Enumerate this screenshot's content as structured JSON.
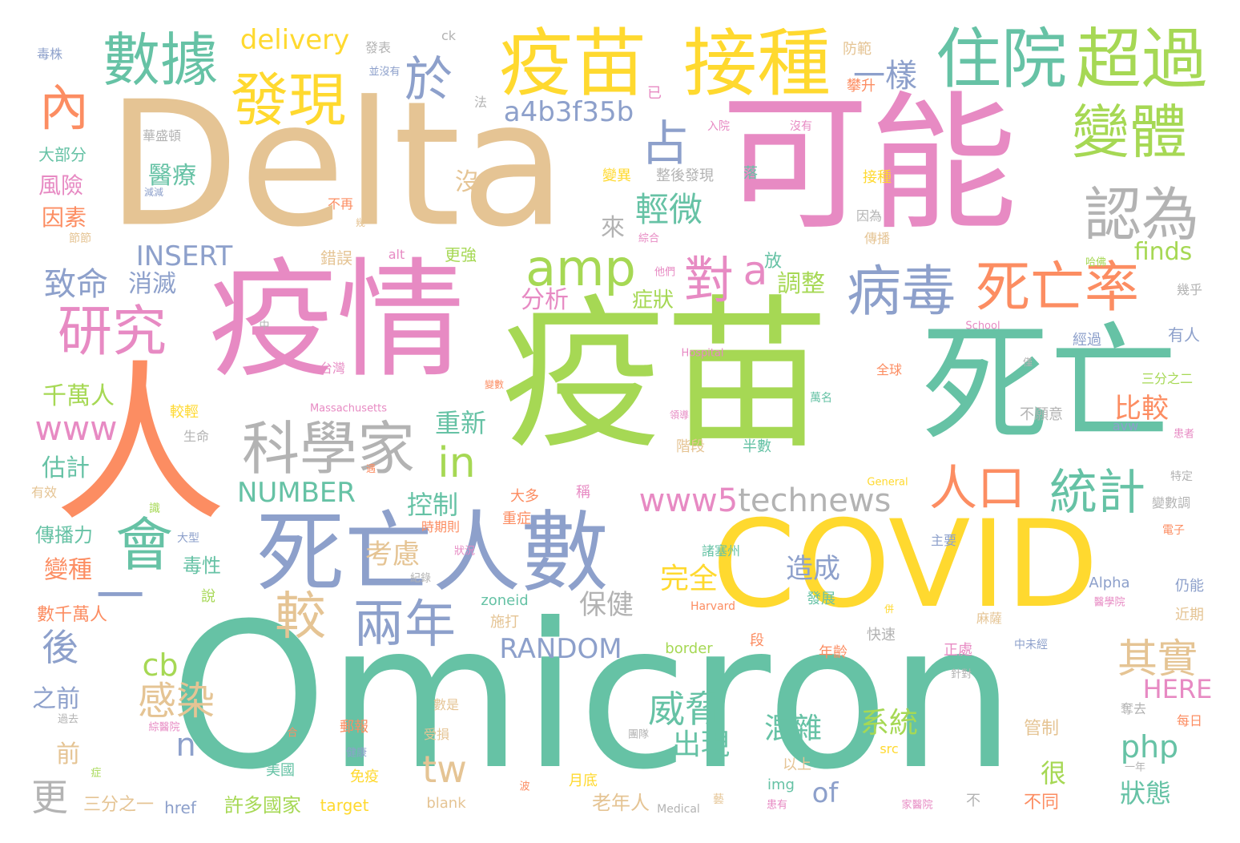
{
  "words": [
    {
      "text": "Omicron",
      "color": "#66c2a5"
    },
    {
      "text": "疫苗",
      "color": "#a6d854"
    },
    {
      "text": "Delta",
      "color": "#e5c494"
    },
    {
      "text": "可能",
      "color": "#e78ac3"
    },
    {
      "text": "疫情",
      "color": "#e78ac3"
    },
    {
      "text": "死亡",
      "color": "#66c2a5"
    },
    {
      "text": "COVID",
      "color": "#ffd92f"
    },
    {
      "text": "人",
      "color": "#fc8d62"
    },
    {
      "text": "死亡人數",
      "color": "#8da0cb"
    },
    {
      "text": "疫苗",
      "color": "#ffd92f"
    },
    {
      "text": "接種",
      "color": "#ffd92f"
    },
    {
      "text": "超過",
      "color": "#a6d854"
    },
    {
      "text": "住院",
      "color": "#66c2a5"
    },
    {
      "text": "數據",
      "color": "#66c2a5"
    },
    {
      "text": "發現",
      "color": "#ffd92f"
    },
    {
      "text": "變體",
      "color": "#a6d854"
    },
    {
      "text": "認為",
      "color": "#b3b3b3"
    },
    {
      "text": "科學家",
      "color": "#b3b3b3"
    },
    {
      "text": "研究",
      "color": "#e78ac3"
    },
    {
      "text": "病毒",
      "color": "#8da0cb"
    },
    {
      "text": "死亡率",
      "color": "#fc8d62"
    },
    {
      "text": "會",
      "color": "#66c2a5"
    },
    {
      "text": "一",
      "color": "#8da0cb"
    },
    {
      "text": "兩年",
      "color": "#8da0cb"
    },
    {
      "text": "較",
      "color": "#e5c494"
    },
    {
      "text": "人口",
      "color": "#fc8d62"
    },
    {
      "text": "統計",
      "color": "#66c2a5"
    },
    {
      "text": "amp",
      "color": "#a6d854"
    },
    {
      "text": "對",
      "color": "#e78ac3"
    },
    {
      "text": "a",
      "color": "#e78ac3"
    },
    {
      "text": "占",
      "color": "#8da0cb"
    },
    {
      "text": "內",
      "color": "#fc8d62"
    },
    {
      "text": "於",
      "color": "#8da0cb"
    },
    {
      "text": "in",
      "color": "#a6d854"
    },
    {
      "text": "www5technews",
      "color": "#e78ac3",
      "split": "www5",
      "rest": "technews",
      "rest_color": "#b3b3b3"
    },
    {
      "text": "其實",
      "color": "#e5c494"
    },
    {
      "text": "威脅",
      "color": "#66c2a5"
    },
    {
      "text": "感染",
      "color": "#e5c494"
    },
    {
      "text": "後",
      "color": "#8da0cb"
    },
    {
      "text": "www",
      "color": "#e78ac3"
    },
    {
      "text": "更",
      "color": "#b3b3b3"
    },
    {
      "text": "tw",
      "color": "#e5c494"
    },
    {
      "text": "n",
      "color": "#8da0cb"
    },
    {
      "text": "cb",
      "color": "#a6d854"
    },
    {
      "text": "一樣",
      "color": "#8da0cb"
    },
    {
      "text": "輕微",
      "color": "#66c2a5"
    },
    {
      "text": "a4b3f35b",
      "color": "#8da0cb"
    },
    {
      "text": "delivery",
      "color": "#ffd92f"
    },
    {
      "text": "致命",
      "color": "#8da0cb"
    },
    {
      "text": "INSERT",
      "color": "#8da0cb"
    },
    {
      "text": "NUMBER",
      "color": "#66c2a5"
    },
    {
      "text": "RANDOM",
      "color": "#8da0cb"
    },
    {
      "text": "php",
      "color": "#66c2a5"
    },
    {
      "text": "of",
      "color": "#8da0cb"
    },
    {
      "text": "出現",
      "color": "#66c2a5"
    },
    {
      "text": "混雜",
      "color": "#66c2a5"
    },
    {
      "text": "系統",
      "color": "#a6d854"
    },
    {
      "text": "完全",
      "color": "#ffd92f"
    },
    {
      "text": "造成",
      "color": "#8da0cb"
    },
    {
      "text": "保健",
      "color": "#b3b3b3"
    },
    {
      "text": "考慮",
      "color": "#e5c494"
    },
    {
      "text": "控制",
      "color": "#66c2a5"
    },
    {
      "text": "重新",
      "color": "#66c2a5"
    },
    {
      "text": "比較",
      "color": "#fc8d62"
    },
    {
      "text": "finds",
      "color": "#a6d854"
    },
    {
      "text": "HERE",
      "color": "#e78ac3"
    },
    {
      "text": "狀態",
      "color": "#66c2a5"
    },
    {
      "text": "很",
      "color": "#a6d854"
    },
    {
      "text": "醫療",
      "color": "#66c2a5"
    },
    {
      "text": "消滅",
      "color": "#8da0cb"
    },
    {
      "text": "分析",
      "color": "#e78ac3"
    },
    {
      "text": "調整",
      "color": "#a6d854"
    },
    {
      "text": "來",
      "color": "#b3b3b3"
    },
    {
      "text": "沒",
      "color": "#e5c494"
    },
    {
      "text": "症狀",
      "color": "#a6d854"
    },
    {
      "text": "千萬人",
      "color": "#a6d854"
    },
    {
      "text": "估計",
      "color": "#66c2a5"
    },
    {
      "text": "之前",
      "color": "#8da0cb"
    },
    {
      "text": "前",
      "color": "#e5c494"
    },
    {
      "text": "變種",
      "color": "#fc8d62"
    },
    {
      "text": "風險",
      "color": "#e78ac3"
    },
    {
      "text": "因素",
      "color": "#fc8d62"
    },
    {
      "text": "毒性",
      "color": "#66c2a5"
    },
    {
      "text": "傳播力",
      "color": "#66c2a5"
    },
    {
      "text": "數千萬人",
      "color": "#fc8d62"
    },
    {
      "text": "三分之一",
      "color": "#e5c494"
    },
    {
      "text": "許多國家",
      "color": "#a6d854"
    },
    {
      "text": "老年人",
      "color": "#e5c494"
    },
    {
      "text": "不同",
      "color": "#fc8d62"
    },
    {
      "text": "管制",
      "color": "#e5c494"
    },
    {
      "text": "放",
      "color": "#66c2a5"
    },
    {
      "text": "更強",
      "color": "#a6d854"
    },
    {
      "text": "錯誤",
      "color": "#e5c494"
    },
    {
      "text": "大部分",
      "color": "#66c2a5"
    },
    {
      "text": "華盛頓",
      "color": "#b3b3b3"
    },
    {
      "text": "毒株",
      "color": "#8da0cb"
    },
    {
      "text": "發表",
      "color": "#b3b3b3"
    },
    {
      "text": "ck",
      "color": "#b3b3b3"
    },
    {
      "text": "防範",
      "color": "#e5c494"
    },
    {
      "text": "攀升",
      "color": "#fc8d62"
    },
    {
      "text": "入院",
      "color": "#e78ac3"
    },
    {
      "text": "沒有",
      "color": "#e78ac3"
    },
    {
      "text": "已",
      "color": "#e78ac3"
    },
    {
      "text": "法",
      "color": "#b3b3b3"
    },
    {
      "text": "並沒有",
      "color": "#8da0cb"
    },
    {
      "text": "變異",
      "color": "#ffd92f"
    },
    {
      "text": "整後發現",
      "color": "#b3b3b3"
    },
    {
      "text": "落",
      "color": "#66c2a5"
    },
    {
      "text": "接種",
      "color": "#ffd92f"
    },
    {
      "text": "因為",
      "color": "#b3b3b3"
    },
    {
      "text": "傳播",
      "color": "#e5c494"
    },
    {
      "text": "綜合",
      "color": "#e78ac3"
    },
    {
      "text": "他們",
      "color": "#e78ac3"
    },
    {
      "text": "哈佛",
      "color": "#a6d854"
    },
    {
      "text": "幾乎",
      "color": "#b3b3b3"
    },
    {
      "text": "有人",
      "color": "#8da0cb"
    },
    {
      "text": "School",
      "color": "#e78ac3"
    },
    {
      "text": "經過",
      "color": "#8da0cb"
    },
    {
      "text": "Hospital",
      "color": "#e78ac3"
    },
    {
      "text": "全球",
      "color": "#fc8d62"
    },
    {
      "text": "三分之二",
      "color": "#a6d854"
    },
    {
      "text": "台灣",
      "color": "#e78ac3"
    },
    {
      "text": "中",
      "color": "#b3b3b3"
    },
    {
      "text": "Massachusetts",
      "color": "#e78ac3"
    },
    {
      "text": "萬名",
      "color": "#66c2a5"
    },
    {
      "text": "不願意",
      "color": "#b3b3b3"
    },
    {
      "text": "avw",
      "color": "#8da0cb"
    },
    {
      "text": "患者",
      "color": "#e78ac3"
    },
    {
      "text": "較輕",
      "color": "#ffd92f"
    },
    {
      "text": "生命",
      "color": "#b3b3b3"
    },
    {
      "text": "階段",
      "color": "#e5c494"
    },
    {
      "text": "半數",
      "color": "#66c2a5"
    },
    {
      "text": "大多",
      "color": "#fc8d62"
    },
    {
      "text": "稱",
      "color": "#e78ac3"
    },
    {
      "text": "重症",
      "color": "#fc8d62"
    },
    {
      "text": "時期則",
      "color": "#fc8d62"
    },
    {
      "text": "General",
      "color": "#ffd92f"
    },
    {
      "text": "特定",
      "color": "#b3b3b3"
    },
    {
      "text": "變數調",
      "color": "#b3b3b3"
    },
    {
      "text": "電子",
      "color": "#fc8d62"
    },
    {
      "text": "主要",
      "color": "#8da0cb"
    },
    {
      "text": "諸塞州",
      "color": "#66c2a5"
    },
    {
      "text": "大型",
      "color": "#8da0cb"
    },
    {
      "text": "紀錄",
      "color": "#b3b3b3"
    },
    {
      "text": "狀況",
      "color": "#e78ac3"
    },
    {
      "text": "有效",
      "color": "#e5c494"
    },
    {
      "text": "說",
      "color": "#a6d854"
    },
    {
      "text": "zoneid",
      "color": "#66c2a5"
    },
    {
      "text": "施打",
      "color": "#e5c494"
    },
    {
      "text": "Harvard",
      "color": "#fc8d62"
    },
    {
      "text": "發展",
      "color": "#66c2a5"
    },
    {
      "text": "Alpha",
      "color": "#8da0cb"
    },
    {
      "text": "醫學院",
      "color": "#e78ac3"
    },
    {
      "text": "仍能",
      "color": "#8da0cb"
    },
    {
      "text": "近期",
      "color": "#e5c494"
    },
    {
      "text": "麻薩",
      "color": "#e5c494"
    },
    {
      "text": "快速",
      "color": "#b3b3b3"
    },
    {
      "text": "border",
      "color": "#a6d854"
    },
    {
      "text": "段",
      "color": "#fc8d62"
    },
    {
      "text": "年齡",
      "color": "#fc8d62"
    },
    {
      "text": "正處",
      "color": "#e78ac3"
    },
    {
      "text": "中未經",
      "color": "#8da0cb"
    },
    {
      "text": "針對",
      "color": "#b3b3b3"
    },
    {
      "text": "奪去",
      "color": "#b3b3b3"
    },
    {
      "text": "每日",
      "color": "#fc8d62"
    },
    {
      "text": "數是",
      "color": "#e5c494"
    },
    {
      "text": "郵報",
      "color": "#fc8d62"
    },
    {
      "text": "受損",
      "color": "#e5c494"
    },
    {
      "text": "src",
      "color": "#ffd92f"
    },
    {
      "text": "綜醫院",
      "color": "#e78ac3"
    },
    {
      "text": "過去",
      "color": "#b3b3b3"
    },
    {
      "text": "合",
      "color": "#fc8d62"
    },
    {
      "text": "健康",
      "color": "#8da0cb"
    },
    {
      "text": "團隊",
      "color": "#b3b3b3"
    },
    {
      "text": "美國",
      "color": "#66c2a5"
    },
    {
      "text": "以上",
      "color": "#e5c494"
    },
    {
      "text": "img",
      "color": "#66c2a5"
    },
    {
      "text": "免疫",
      "color": "#ffd92f"
    },
    {
      "text": "月底",
      "color": "#ffd92f"
    },
    {
      "text": "一年",
      "color": "#b3b3b3"
    },
    {
      "text": "症",
      "color": "#a6d854"
    },
    {
      "text": "波",
      "color": "#fc8d62"
    },
    {
      "text": "href",
      "color": "#8da0cb"
    },
    {
      "text": "target",
      "color": "#ffd92f"
    },
    {
      "text": "blank",
      "color": "#e5c494"
    },
    {
      "text": "Medical",
      "color": "#b3b3b3"
    },
    {
      "text": "患有",
      "color": "#e78ac3"
    },
    {
      "text": "家醫院",
      "color": "#e78ac3"
    },
    {
      "text": "不",
      "color": "#b3b3b3"
    },
    {
      "text": "alt",
      "color": "#e78ac3"
    },
    {
      "text": "節節",
      "color": "#e5c494"
    },
    {
      "text": "減減",
      "color": "#8da0cb"
    },
    {
      "text": "不再",
      "color": "#fc8d62"
    },
    {
      "text": "幾",
      "color": "#e5c494"
    },
    {
      "text": "遇",
      "color": "#fc8d62"
    },
    {
      "text": "領導",
      "color": "#e78ac3"
    },
    {
      "text": "變數",
      "color": "#fc8d62"
    },
    {
      "text": "僅",
      "color": "#b3b3b3"
    },
    {
      "text": "識",
      "color": "#a6d854"
    },
    {
      "text": "併",
      "color": "#ffd92f"
    },
    {
      "text": "藝",
      "color": "#e5c494"
    }
  ]
}
